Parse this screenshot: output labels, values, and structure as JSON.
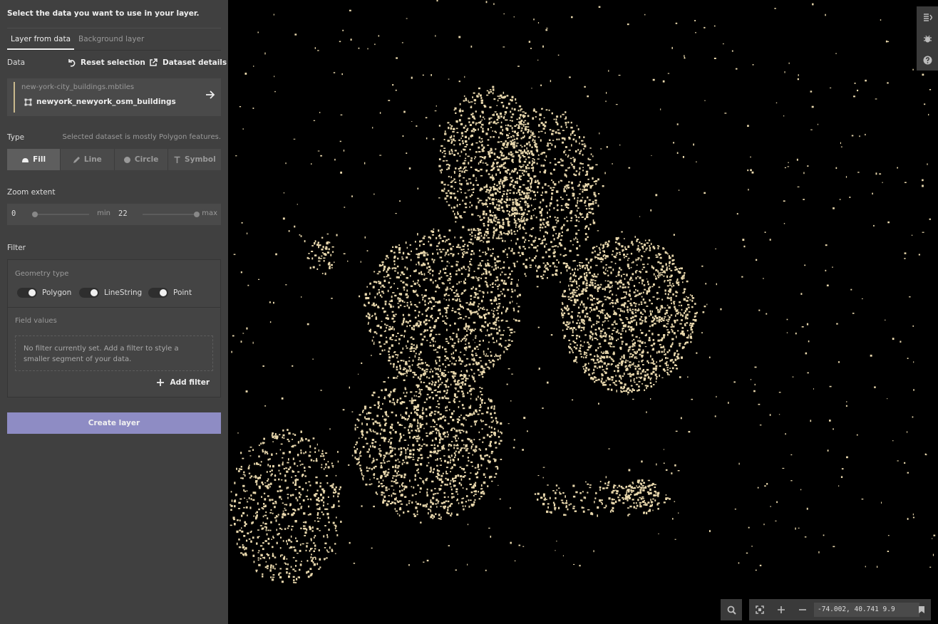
{
  "sidebar": {
    "title": "Select the data you want to use in your layer.",
    "tabs": [
      {
        "label": "Layer from data",
        "active": true
      },
      {
        "label": "Background layer",
        "active": false
      }
    ],
    "data_label": "Data",
    "reset_selection": "Reset selection",
    "dataset_details": "Dataset details",
    "dataset": {
      "source": "new-york-city_buildings.mbtiles",
      "layer": "newyork_newyork_osm_buildings"
    },
    "type_label": "Type",
    "type_hint": "Selected dataset is mostly Polygon features.",
    "types": [
      {
        "label": "Fill",
        "icon": "fill-icon",
        "selected": true
      },
      {
        "label": "Line",
        "icon": "pencil-icon",
        "selected": false
      },
      {
        "label": "Circle",
        "icon": "circle-icon",
        "selected": false
      },
      {
        "label": "Symbol",
        "icon": "text-t-icon",
        "selected": false
      }
    ],
    "zoom_label": "Zoom extent",
    "zoom_min": {
      "value": "0",
      "unit": "min"
    },
    "zoom_max": {
      "value": "22",
      "unit": "max"
    },
    "filter_label": "Filter",
    "geometry_type_label": "Geometry type",
    "geometry_types": [
      {
        "label": "Polygon",
        "on": true
      },
      {
        "label": "LineString",
        "on": true
      },
      {
        "label": "Point",
        "on": true
      }
    ],
    "field_values_label": "Field values",
    "no_filter_text": "No filter currently set. Add a filter to style a smaller segment of your data.",
    "add_filter": "Add filter",
    "create_layer": "Create layer"
  },
  "map": {
    "background": "#000000",
    "feature_color": "#e8d7ac",
    "coordinates": "-74.002, 40.741 9.9"
  },
  "colors": {
    "sidebar_bg": "#404040",
    "accent_button": "#8e8cc4",
    "dataset_bar": "#c9b98d"
  }
}
